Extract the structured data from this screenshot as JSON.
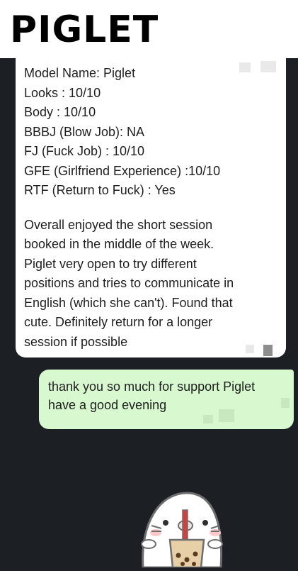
{
  "header": {
    "title": "PIGLET"
  },
  "received_message": {
    "lines": [
      "Model Name: Piglet",
      "Looks : 10/10",
      "Body : 10/10",
      "BBBJ (Blow Job): NA",
      "FJ (Fuck Job) : 10/10",
      "GFE (Girlfriend Experience) :10/10",
      "RTF (Return to Fuck) : Yes"
    ],
    "paragraph": [
      "Overall enjoyed the short session",
      "booked in the middle of the week.",
      "Piglet very open to try different",
      "positions and tries to communicate in",
      "English (which she can't). Found that",
      "cute. Definitely return for a longer",
      "session if possible"
    ]
  },
  "sent_message": {
    "lines": [
      "thank you so much for support Piglet",
      "have a good evening"
    ]
  },
  "sticker": {
    "icon": "seal-bubble-tea-sticker"
  },
  "colors": {
    "background": "#1c1f24",
    "received_bubble": "#ffffff",
    "sent_bubble": "#d8f8cf"
  }
}
